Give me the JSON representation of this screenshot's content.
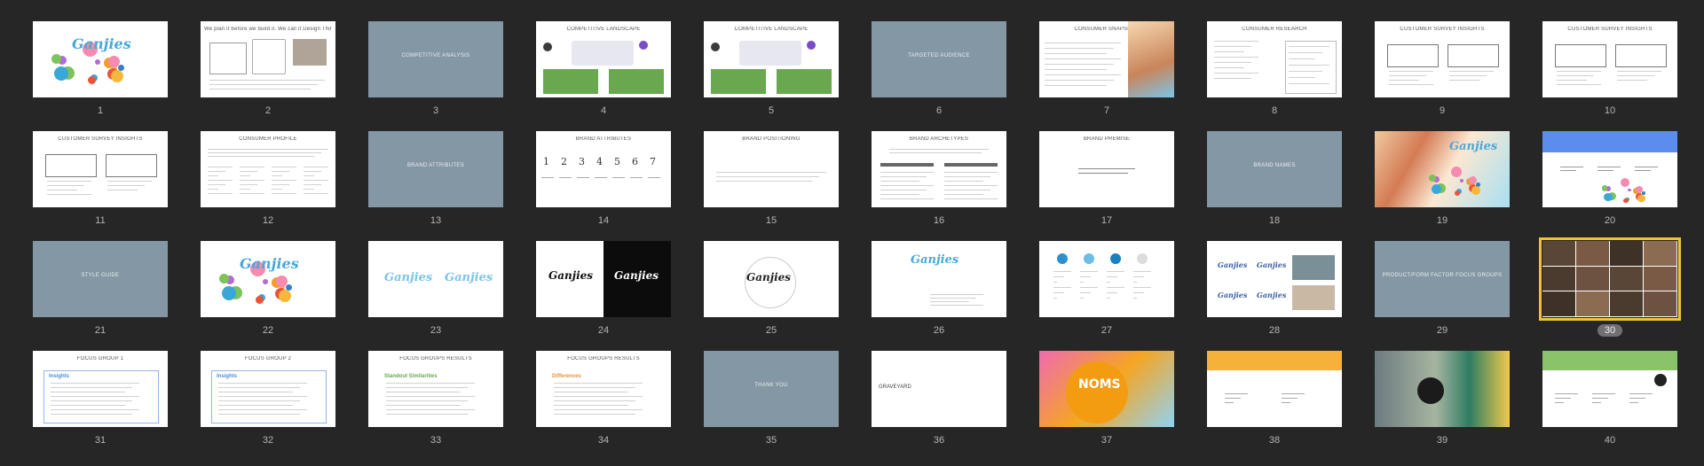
{
  "slides": [
    {
      "number": "1",
      "bg": "white",
      "design": "logo-splash",
      "logo": "Ganjies"
    },
    {
      "number": "2",
      "bg": "white",
      "design": "sketch",
      "title": "We plan it before we build it. We call it Design Thinking."
    },
    {
      "number": "3",
      "bg": "slate",
      "design": "section",
      "center": "COMPETITIVE ANALYSIS"
    },
    {
      "number": "4",
      "bg": "white",
      "design": "landscape",
      "title": "COMPETITIVE LANDSCAPE"
    },
    {
      "number": "5",
      "bg": "white",
      "design": "landscape",
      "title": "COMPETITIVE LANDSCAPE"
    },
    {
      "number": "6",
      "bg": "slate",
      "design": "section",
      "center": "TARGETED AUDIENCE"
    },
    {
      "number": "7",
      "bg": "white",
      "design": "snapshot",
      "title": "CONSUMER SNAPSHOT"
    },
    {
      "number": "8",
      "bg": "white",
      "design": "research",
      "title": "CONSUMER RESEARCH"
    },
    {
      "number": "9",
      "bg": "white",
      "design": "survey",
      "title": "CUSTOMER SURVEY INSIGHTS"
    },
    {
      "number": "10",
      "bg": "white",
      "design": "survey",
      "title": "CUSTOMER SURVEY INSIGHTS"
    },
    {
      "number": "11",
      "bg": "white",
      "design": "survey",
      "title": "CUSTOMER SURVEY INSIGHTS"
    },
    {
      "number": "12",
      "bg": "white",
      "design": "profile",
      "title": "CONSUMER PROFILE"
    },
    {
      "number": "13",
      "bg": "slate",
      "design": "section",
      "center": "BRAND ATTRIBUTES"
    },
    {
      "number": "14",
      "bg": "white",
      "design": "attributes",
      "title": "BRAND ATTRIBUTES",
      "digits": [
        "1",
        "2",
        "3",
        "4",
        "5",
        "6",
        "7"
      ]
    },
    {
      "number": "15",
      "bg": "white",
      "design": "positioning",
      "title": "BRAND POSITIONING"
    },
    {
      "number": "16",
      "bg": "white",
      "design": "archetypes",
      "title": "BRAND ARCHETYPES"
    },
    {
      "number": "17",
      "bg": "white",
      "design": "premise",
      "title": "BRAND PREMISE"
    },
    {
      "number": "18",
      "bg": "slate",
      "design": "section",
      "center": "BRAND NAMES"
    },
    {
      "number": "19",
      "bg": "white",
      "design": "photo-girl",
      "logo": "Ganjies"
    },
    {
      "number": "20",
      "bg": "white",
      "design": "blue-header"
    },
    {
      "number": "21",
      "bg": "slate",
      "design": "section",
      "center": "STYLE GUIDE"
    },
    {
      "number": "22",
      "bg": "white",
      "design": "logo-splash",
      "logo": "Ganjies"
    },
    {
      "number": "23",
      "bg": "white",
      "design": "two-logos",
      "logo": "Ganjies"
    },
    {
      "number": "24",
      "bg": "white",
      "design": "black-white-logo",
      "logo": "Ganjies"
    },
    {
      "number": "25",
      "bg": "white",
      "design": "logo-construction",
      "logo": "Ganjies"
    },
    {
      "number": "26",
      "bg": "white",
      "design": "logo-spec",
      "logo": "Ganjies"
    },
    {
      "number": "27",
      "bg": "white",
      "design": "palette"
    },
    {
      "number": "28",
      "bg": "white",
      "design": "mockups",
      "logo": "Ganjies"
    },
    {
      "number": "29",
      "bg": "slate",
      "design": "section",
      "center": "PRODUCT/FORM FACTOR FOCUS GROUPS"
    },
    {
      "number": "30",
      "bg": "white",
      "design": "photo-grid",
      "selected": true
    },
    {
      "number": "31",
      "bg": "white",
      "design": "focus",
      "title": "FOCUS GROUP 1",
      "label": "Insights",
      "label_color": "#4a90d9"
    },
    {
      "number": "32",
      "bg": "white",
      "design": "focus",
      "title": "FOCUS GROUP 2",
      "label": "Insights",
      "label_color": "#4a90d9"
    },
    {
      "number": "33",
      "bg": "white",
      "design": "results",
      "title": "FOCUS GROUPS RESULTS",
      "label": "Standout Similarities",
      "label_color": "#6aa84f"
    },
    {
      "number": "34",
      "bg": "white",
      "design": "results",
      "title": "FOCUS GROUPS RESULTS",
      "label": "Differences",
      "label_color": "#e69138"
    },
    {
      "number": "35",
      "bg": "slate",
      "design": "section",
      "center": "THANK YOU"
    },
    {
      "number": "36",
      "bg": "white",
      "design": "graveyard",
      "center": "GRAVEYARD"
    },
    {
      "number": "37",
      "bg": "white",
      "design": "noms",
      "logo": "NOMS"
    },
    {
      "number": "38",
      "bg": "white",
      "design": "orange-header"
    },
    {
      "number": "39",
      "bg": "white",
      "design": "photo-man"
    },
    {
      "number": "40",
      "bg": "white",
      "design": "green-header"
    }
  ],
  "colors": {
    "background": "#262626",
    "slate": "#8497a5",
    "selection": "#f1c232",
    "logo_blue": "#4aa8d8"
  }
}
